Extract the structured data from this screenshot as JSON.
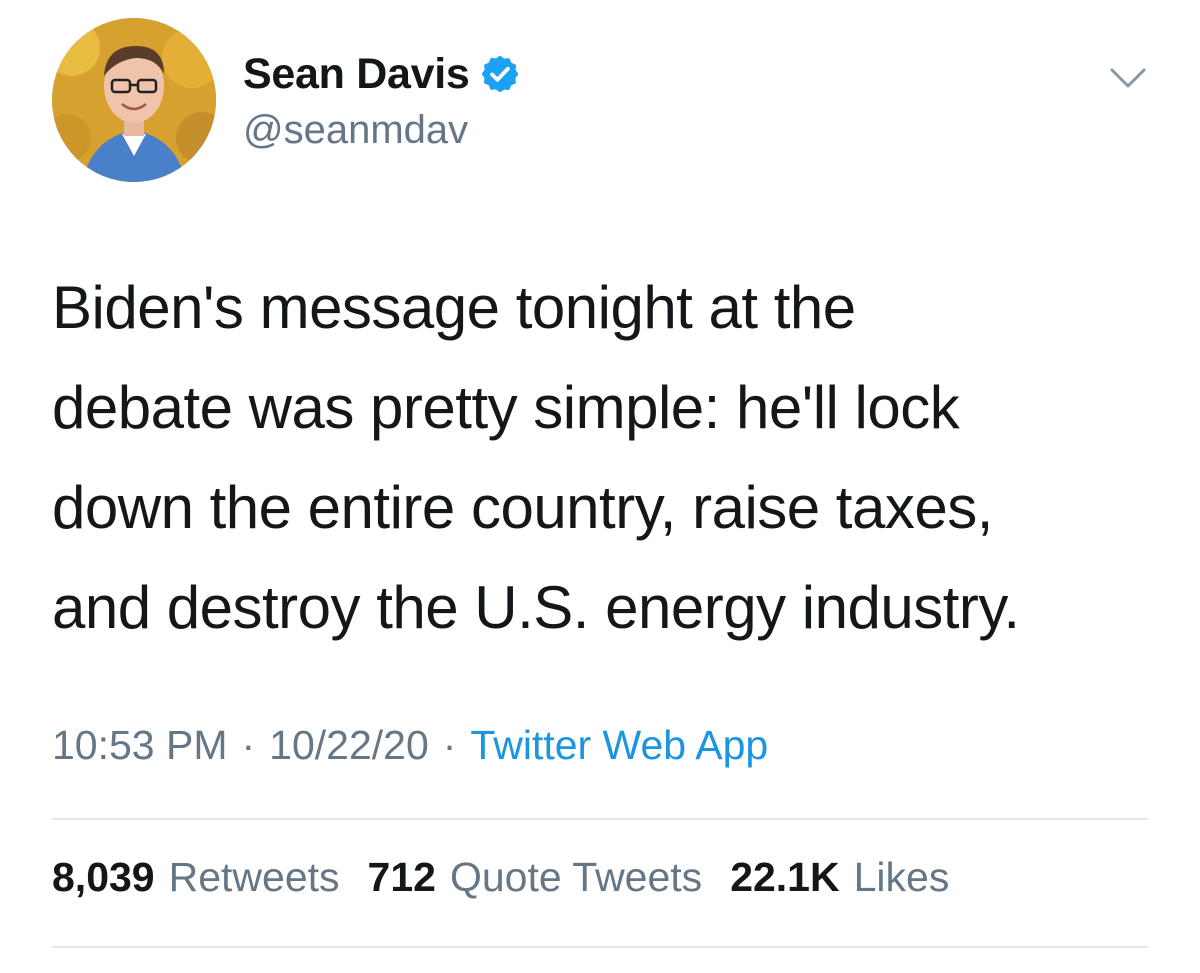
{
  "author": {
    "display_name": "Sean Davis",
    "handle": "@seanmdav",
    "verified_icon": "verified-badge-icon",
    "avatar_icon": "profile-photo"
  },
  "tweet": {
    "text_lines": [
      "Biden's message tonight at the",
      "debate was pretty simple: he'll lock",
      "down the entire country, raise taxes,",
      "and destroy the U.S. energy industry."
    ],
    "time": "10:53 PM",
    "date": "10/22/20",
    "separator": "·",
    "source": "Twitter Web App"
  },
  "stats": {
    "retweets": {
      "count": "8,039",
      "label": "Retweets"
    },
    "quote_tweets": {
      "count": "712",
      "label": "Quote Tweets"
    },
    "likes": {
      "count": "22.1K",
      "label": "Likes"
    }
  },
  "colors": {
    "text": "#14171a",
    "secondary": "#657786",
    "link": "#1b95e0",
    "verified": "#1da1f2",
    "divider": "#e1e8ed"
  },
  "menu_icon": "chevron-down-icon"
}
